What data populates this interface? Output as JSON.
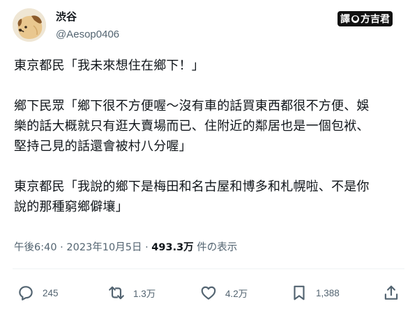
{
  "author": {
    "display_name": "渋谷",
    "handle": "@Aesop0406"
  },
  "watermark": {
    "left": "譯",
    "middle": "●",
    "right": "方吉君"
  },
  "tweet": {
    "paragraphs": [
      [
        "東京都民「我未來想住在鄉下！」"
      ],
      [
        "鄉下民眾「鄉下很不方便喔～沒有車的話買東西都很不方便、娛",
        "樂的話大概就只有逛大賣場而已、住附近的鄰居也是一個包袱、",
        "堅持己見的話還會被村八分喔」"
      ],
      [
        "東京都民「我說的鄉下是梅田和名古屋和博多和札幌啦、不是你",
        "說的那種窮鄉僻壤」"
      ]
    ]
  },
  "meta": {
    "time": "午後6:40",
    "date": "2023年10月5日",
    "views": "493.3万",
    "views_label": "件の表示"
  },
  "actions": {
    "replies": "245",
    "reposts": "1.3万",
    "likes": "4.2万",
    "bookmarks": "1,388"
  }
}
